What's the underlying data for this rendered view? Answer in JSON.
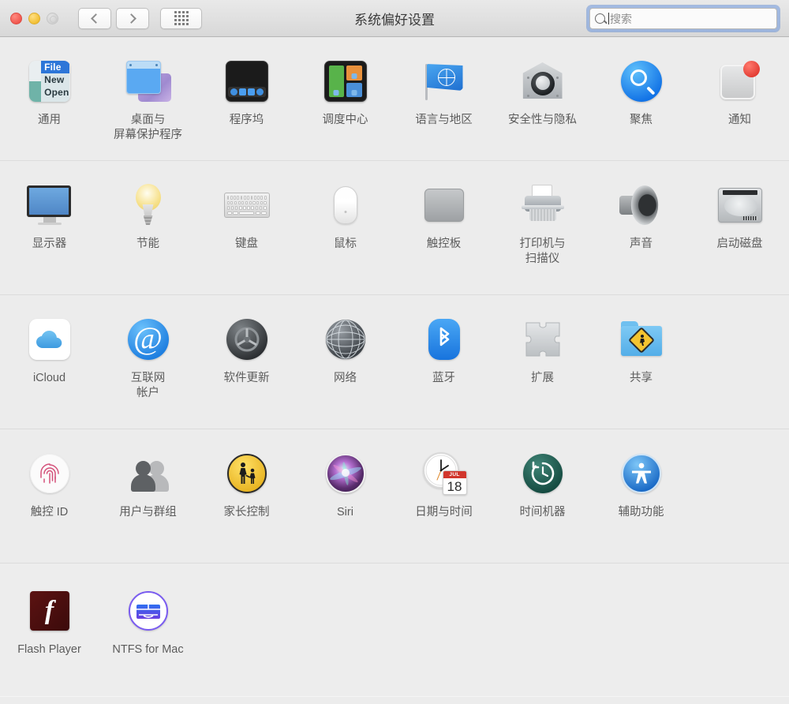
{
  "window": {
    "title": "系统偏好设置",
    "traffic_lights": [
      "close",
      "minimize",
      "zoom-disabled"
    ],
    "nav": {
      "back_label": "‹",
      "forward_label": "›",
      "grid_label": "show-all"
    }
  },
  "search": {
    "placeholder": "搜索",
    "value": "",
    "focused": true,
    "focus_ring_color": "#6a96de"
  },
  "rows": [
    {
      "id": "row-personal",
      "items": [
        {
          "name": "general",
          "label": "通用",
          "icon": "general-icon"
        },
        {
          "name": "desktop",
          "label": "桌面与\n屏幕保护程序",
          "icon": "desktop-screensaver-icon"
        },
        {
          "name": "dock",
          "label": "程序坞",
          "icon": "dock-icon"
        },
        {
          "name": "mission-control",
          "label": "调度中心",
          "icon": "mission-control-icon"
        },
        {
          "name": "language",
          "label": "语言与地区",
          "icon": "language-region-flag-icon"
        },
        {
          "name": "security",
          "label": "安全性与隐私",
          "icon": "security-privacy-house-icon"
        },
        {
          "name": "spotlight",
          "label": "聚焦",
          "icon": "spotlight-magnifier-icon"
        },
        {
          "name": "notifications",
          "label": "通知",
          "icon": "notifications-icon",
          "badge": true
        }
      ]
    },
    {
      "id": "row-hardware",
      "items": [
        {
          "name": "displays",
          "label": "显示器",
          "icon": "display-monitor-icon"
        },
        {
          "name": "energy",
          "label": "节能",
          "icon": "lightbulb-icon"
        },
        {
          "name": "keyboard",
          "label": "键盘",
          "icon": "keyboard-icon"
        },
        {
          "name": "mouse",
          "label": "鼠标",
          "icon": "mouse-icon"
        },
        {
          "name": "trackpad",
          "label": "触控板",
          "icon": "trackpad-icon"
        },
        {
          "name": "printers",
          "label": "打印机与\n扫描仪",
          "icon": "printer-icon"
        },
        {
          "name": "sound",
          "label": "声音",
          "icon": "speaker-icon"
        },
        {
          "name": "startupdisk",
          "label": "启动磁盘",
          "icon": "hard-disk-icon"
        }
      ]
    },
    {
      "id": "row-internet",
      "items": [
        {
          "name": "icloud",
          "label": "iCloud",
          "icon": "icloud-cloud-icon"
        },
        {
          "name": "internet-accounts",
          "label": "互联网\n帐户",
          "icon": "at-sign-icon"
        },
        {
          "name": "software-update",
          "label": "软件更新",
          "icon": "gear-icon"
        },
        {
          "name": "network",
          "label": "网络",
          "icon": "network-globe-icon"
        },
        {
          "name": "bluetooth",
          "label": "蓝牙",
          "icon": "bluetooth-icon"
        },
        {
          "name": "extensions",
          "label": "扩展",
          "icon": "puzzle-piece-icon"
        },
        {
          "name": "sharing",
          "label": "共享",
          "icon": "shared-folder-icon"
        }
      ]
    },
    {
      "id": "row-system",
      "items": [
        {
          "name": "touch-id",
          "label": "触控 ID",
          "icon": "fingerprint-icon"
        },
        {
          "name": "users",
          "label": "用户与群组",
          "icon": "users-group-icon"
        },
        {
          "name": "parental",
          "label": "家长控制",
          "icon": "parental-controls-icon"
        },
        {
          "name": "siri",
          "label": "Siri",
          "icon": "siri-orb-icon"
        },
        {
          "name": "datetime",
          "label": "日期与时间",
          "icon": "clock-calendar-icon",
          "calendar_month": "JUL",
          "calendar_day": "18"
        },
        {
          "name": "time-machine",
          "label": "时间机器",
          "icon": "time-machine-icon"
        },
        {
          "name": "accessibility",
          "label": "辅助功能",
          "icon": "accessibility-icon"
        }
      ]
    },
    {
      "id": "row-third-party",
      "items": [
        {
          "name": "flash-player",
          "label": "Flash Player",
          "icon": "flash-player-icon"
        },
        {
          "name": "ntfs-for-mac",
          "label": "NTFS for Mac",
          "icon": "ntfs-for-mac-icon"
        }
      ]
    }
  ],
  "colors": {
    "window_background": "#ececec",
    "titlebar_top": "#e9e9e9",
    "titlebar_bottom": "#d8d8d8",
    "label_text": "#5c5c5c",
    "title_text": "#3b3b3b",
    "separator": "#dcdcdc",
    "close_red": "#f1584f",
    "minimize_yellow": "#f2c035",
    "zoom_gray": "#d2d2d2",
    "notification_badge": "#e23b32"
  }
}
